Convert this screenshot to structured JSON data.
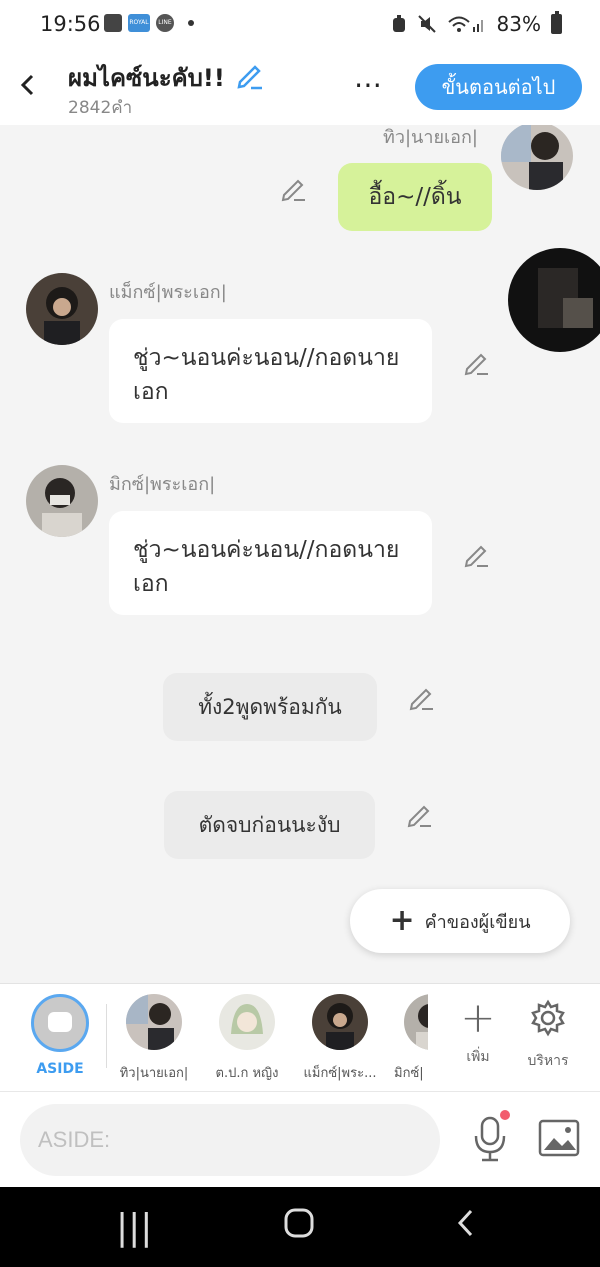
{
  "status_bar": {
    "time": "19:56",
    "app_icon_text": "ROYAL TOON",
    "line_icon_text": "LINE",
    "battery": "83%"
  },
  "header": {
    "title": "ผมไคซ์นะคับ!!",
    "word_count": "2842คำ",
    "more_icon": "⋯",
    "next_button": "ขั้นตอนต่อไป",
    "accent_color": "#3d9cf0"
  },
  "chat": {
    "messages": [
      {
        "speaker": "ทิว|นายเอก|",
        "text": "อื้อ~//ดิ้น",
        "side": "right",
        "style": "green"
      },
      {
        "speaker": "แม็กซ์|พระเอก|",
        "text": "ชู่ว~นอนค่ะนอน//กอดนายเอก",
        "side": "left",
        "style": "white"
      },
      {
        "speaker": "มิกซ์|พระเอก|",
        "text": "ชู่ว~นอนค่ะนอน//กอดนายเอก",
        "side": "left",
        "style": "white"
      },
      {
        "speaker": "",
        "text": "ทั้ง2พูดพร้อมกัน",
        "side": "center",
        "style": "aside"
      },
      {
        "speaker": "",
        "text": "ตัดจบก่อนนะงับ",
        "side": "center",
        "style": "aside"
      }
    ],
    "author_note_button": "คำของผู้เขียน"
  },
  "character_bar": {
    "aside_label": "ASIDE",
    "characters": [
      {
        "label": "ทิว|นายเอก|"
      },
      {
        "label": "ต.ป.ก หญิง"
      },
      {
        "label": "แม็กซ์|พระ..."
      },
      {
        "label": "มิกซ์|"
      }
    ],
    "add_label": "เพิ่ม",
    "manage_label": "บริหาร"
  },
  "input": {
    "placeholder": "ASIDE:"
  },
  "navbar": {
    "recent": "|||",
    "home": "○",
    "back": "<"
  }
}
